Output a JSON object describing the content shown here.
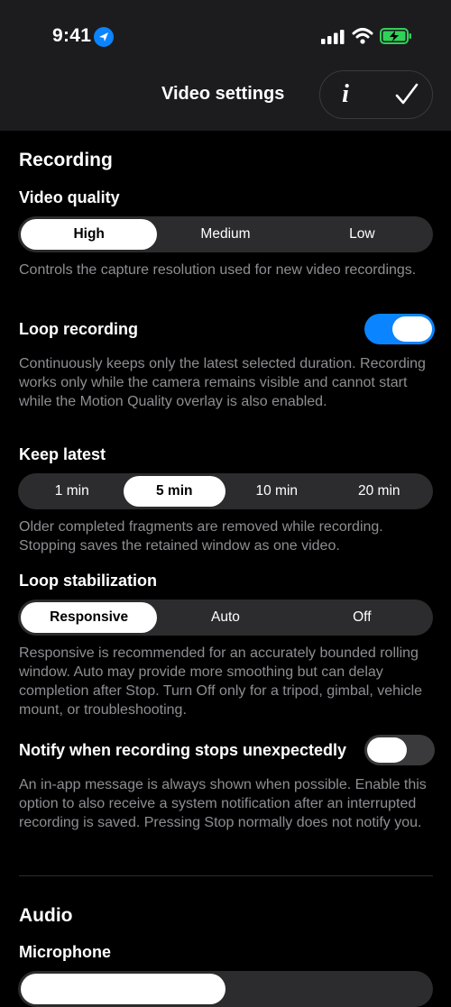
{
  "status_bar": {
    "time": "9:41"
  },
  "nav": {
    "title": "Video settings",
    "info_label": "i"
  },
  "recording": {
    "title": "Recording",
    "video_quality": {
      "label": "Video quality",
      "options": [
        "High",
        "Medium",
        "Low"
      ],
      "selected": "High",
      "description": "Controls the capture resolution used for new video recordings."
    },
    "loop_recording": {
      "label": "Loop recording",
      "enabled": true,
      "description": "Continuously keeps only the latest selected duration. Recording works only while the camera remains visible and cannot start while the Motion Quality overlay is also enabled."
    },
    "keep_latest": {
      "label": "Keep latest",
      "options": [
        "1 min",
        "5 min",
        "10 min",
        "20 min"
      ],
      "selected": "5 min",
      "description": "Older completed fragments are removed while recording. Stopping saves the retained window as one video."
    },
    "loop_stabilization": {
      "label": "Loop stabilization",
      "options": [
        "Responsive",
        "Auto",
        "Off"
      ],
      "selected": "Responsive",
      "description": "Responsive is recommended for an accurately bounded rolling window. Auto may provide more smoothing but can delay completion after Stop. Turn Off only for a tripod, gimbal, vehicle mount, or troubleshooting."
    },
    "notify": {
      "label": "Notify when recording stops unexpectedly",
      "enabled": false,
      "description": "An in-app message is always shown when possible. Enable this option to also receive a system notification after an interrupted recording is saved. Pressing Stop normally does not notify you."
    }
  },
  "audio": {
    "title": "Audio",
    "microphone": {
      "label": "Microphone"
    }
  },
  "colors": {
    "accent": "#0a84ff",
    "battery": "#30d158",
    "toggle_off": "#3a3a3c",
    "segment_bg": "#2c2c2e"
  }
}
